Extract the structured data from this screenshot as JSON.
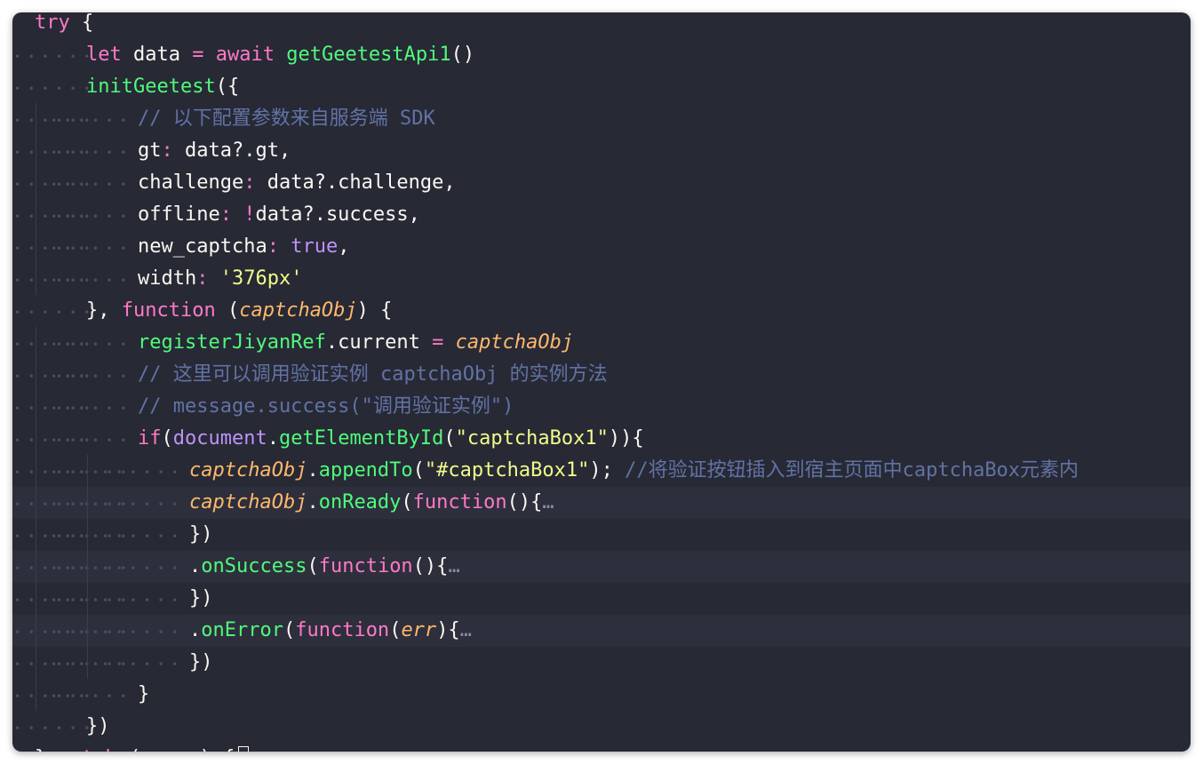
{
  "editor": {
    "theme_colors": {
      "background": "#272935",
      "keyword": "#ff79c6",
      "function": "#50fa7b",
      "text": "#f8f8f2",
      "comment": "#6272a4",
      "string": "#f1fa8c",
      "boolean": "#bd93f9",
      "param": "#ffb86c"
    },
    "lines": [
      {
        "indent": 0,
        "tokens": [
          {
            "c": "kw",
            "t": "try"
          },
          {
            "c": "tx",
            "t": " {"
          }
        ]
      },
      {
        "indent": 1,
        "tokens": [
          {
            "c": "kw",
            "t": "let"
          },
          {
            "c": "tx",
            "t": " data "
          },
          {
            "c": "op",
            "t": "="
          },
          {
            "c": "tx",
            "t": " "
          },
          {
            "c": "kw",
            "t": "await"
          },
          {
            "c": "tx",
            "t": " "
          },
          {
            "c": "fn",
            "t": "getGeetestApi1"
          },
          {
            "c": "tx",
            "t": "()"
          }
        ]
      },
      {
        "indent": 1,
        "tokens": [
          {
            "c": "fn",
            "t": "initGeetest"
          },
          {
            "c": "tx",
            "t": "({"
          }
        ]
      },
      {
        "indent": 2,
        "tokens": [
          {
            "c": "cm",
            "t": "// 以下配置参数来自服务端 SDK"
          }
        ]
      },
      {
        "indent": 2,
        "tokens": [
          {
            "c": "tx",
            "t": "gt"
          },
          {
            "c": "op",
            "t": ":"
          },
          {
            "c": "tx",
            "t": " data?.gt,"
          }
        ]
      },
      {
        "indent": 2,
        "tokens": [
          {
            "c": "tx",
            "t": "challenge"
          },
          {
            "c": "op",
            "t": ":"
          },
          {
            "c": "tx",
            "t": " data?.challenge,"
          }
        ]
      },
      {
        "indent": 2,
        "tokens": [
          {
            "c": "tx",
            "t": "offline"
          },
          {
            "c": "op",
            "t": ":"
          },
          {
            "c": "tx",
            "t": " "
          },
          {
            "c": "op",
            "t": "!"
          },
          {
            "c": "tx",
            "t": "data?.success,"
          }
        ]
      },
      {
        "indent": 2,
        "tokens": [
          {
            "c": "tx",
            "t": "new_captcha"
          },
          {
            "c": "op",
            "t": ":"
          },
          {
            "c": "tx",
            "t": " "
          },
          {
            "c": "bl",
            "t": "true"
          },
          {
            "c": "tx",
            "t": ","
          }
        ]
      },
      {
        "indent": 2,
        "tokens": [
          {
            "c": "tx",
            "t": "width"
          },
          {
            "c": "op",
            "t": ":"
          },
          {
            "c": "tx",
            "t": " "
          },
          {
            "c": "st",
            "t": "'376px'"
          }
        ]
      },
      {
        "indent": 1,
        "tokens": [
          {
            "c": "tx",
            "t": "}, "
          },
          {
            "c": "kw",
            "t": "function"
          },
          {
            "c": "tx",
            "t": " ("
          },
          {
            "c": "pr",
            "t": "captchaObj"
          },
          {
            "c": "tx",
            "t": ") {"
          }
        ]
      },
      {
        "indent": 2,
        "tokens": [
          {
            "c": "fn",
            "t": "registerJiyanRef"
          },
          {
            "c": "tx",
            "t": ".current "
          },
          {
            "c": "op",
            "t": "="
          },
          {
            "c": "tx",
            "t": " "
          },
          {
            "c": "pr",
            "t": "captchaObj"
          }
        ]
      },
      {
        "indent": 2,
        "tokens": [
          {
            "c": "cm",
            "t": "// 这里可以调用验证实例 captchaObj 的实例方法"
          }
        ]
      },
      {
        "indent": 2,
        "tokens": [
          {
            "c": "cm",
            "t": "// message.success(\"调用验证实例\")"
          }
        ]
      },
      {
        "indent": 2,
        "tokens": [
          {
            "c": "kw",
            "t": "if"
          },
          {
            "c": "tx",
            "t": "("
          },
          {
            "c": "bl",
            "t": "document"
          },
          {
            "c": "tx",
            "t": "."
          },
          {
            "c": "fn",
            "t": "getElementById"
          },
          {
            "c": "tx",
            "t": "("
          },
          {
            "c": "st",
            "t": "\"captchaBox1\""
          },
          {
            "c": "tx",
            "t": ")){"
          }
        ]
      },
      {
        "indent": 3,
        "tokens": [
          {
            "c": "pr",
            "t": "captchaObj"
          },
          {
            "c": "tx",
            "t": "."
          },
          {
            "c": "fn",
            "t": "appendTo"
          },
          {
            "c": "tx",
            "t": "("
          },
          {
            "c": "st",
            "t": "\"#captchaBox1\""
          },
          {
            "c": "tx",
            "t": "); "
          },
          {
            "c": "cm",
            "t": "//将验证按钮插入到宿主页面中captchaBox元素内"
          }
        ]
      },
      {
        "indent": 3,
        "hl": true,
        "tokens": [
          {
            "c": "pr",
            "t": "captchaObj"
          },
          {
            "c": "tx",
            "t": "."
          },
          {
            "c": "fn",
            "t": "onReady"
          },
          {
            "c": "tx",
            "t": "("
          },
          {
            "c": "kw",
            "t": "function"
          },
          {
            "c": "tx",
            "t": "(){"
          },
          {
            "c": "fold",
            "t": "…"
          }
        ]
      },
      {
        "indent": 3,
        "tokens": [
          {
            "c": "tx",
            "t": "})"
          }
        ]
      },
      {
        "indent": 3,
        "hl": true,
        "tokens": [
          {
            "c": "tx",
            "t": "."
          },
          {
            "c": "fn",
            "t": "onSuccess"
          },
          {
            "c": "tx",
            "t": "("
          },
          {
            "c": "kw",
            "t": "function"
          },
          {
            "c": "tx",
            "t": "(){"
          },
          {
            "c": "fold",
            "t": "…"
          }
        ]
      },
      {
        "indent": 3,
        "tokens": [
          {
            "c": "tx",
            "t": "})"
          }
        ]
      },
      {
        "indent": 3,
        "hl": true,
        "tokens": [
          {
            "c": "tx",
            "t": "."
          },
          {
            "c": "fn",
            "t": "onError"
          },
          {
            "c": "tx",
            "t": "("
          },
          {
            "c": "kw",
            "t": "function"
          },
          {
            "c": "tx",
            "t": "("
          },
          {
            "c": "pr",
            "t": "err"
          },
          {
            "c": "tx",
            "t": "){"
          },
          {
            "c": "fold",
            "t": "…"
          }
        ]
      },
      {
        "indent": 3,
        "tokens": [
          {
            "c": "tx",
            "t": "})"
          }
        ]
      },
      {
        "indent": 2,
        "tokens": [
          {
            "c": "tx",
            "t": "}"
          }
        ]
      },
      {
        "indent": 1,
        "tokens": [
          {
            "c": "tx",
            "t": "})"
          }
        ]
      },
      {
        "indent": 0,
        "tokens": [
          {
            "c": "tx",
            "t": "} "
          },
          {
            "c": "kw",
            "t": "catch"
          },
          {
            "c": "tx",
            "t": " (error) {"
          }
        ]
      }
    ]
  }
}
